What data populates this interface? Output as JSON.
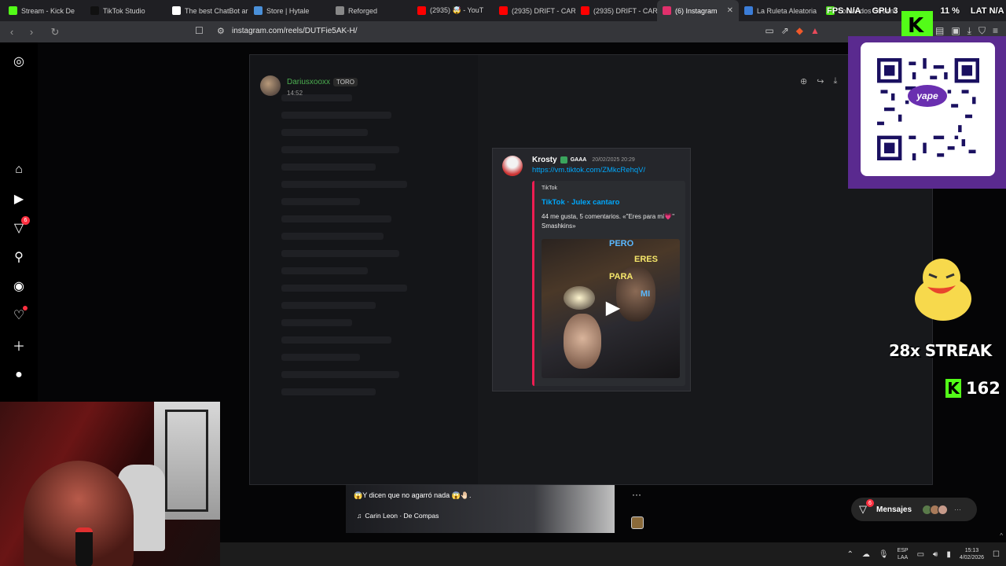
{
  "tabs": [
    {
      "label": "Stream - Kick De",
      "color": "#53fc18"
    },
    {
      "label": "TikTok Studio",
      "color": "#111111"
    },
    {
      "label": "The best ChatBot ar",
      "color": "#ffffff"
    },
    {
      "label": "Store | Hytale",
      "color": "#4a90d9"
    },
    {
      "label": "Reforged",
      "color": "#888888"
    },
    {
      "label": "(2935) 🤯 - YouT",
      "color": "#ff0000"
    },
    {
      "label": "(2935) DRIFT - CAR",
      "color": "#ff0000"
    },
    {
      "label": "(2935) DRIFT - CAR",
      "color": "#ff0000"
    },
    {
      "label": "(6) Instagram",
      "color": "#e1306c",
      "active": true
    },
    {
      "label": "La Ruleta Aleatoria",
      "color": "#3b7dd8"
    },
    {
      "label": "comandos Stream",
      "color": "#53fc18"
    }
  ],
  "address": {
    "url": "instagram.com/reels/DUTFie5AK-H/"
  },
  "overlay": {
    "fps_label": "FPS",
    "fps_value": "N/A",
    "gpu_label": "GPU",
    "gpu_value": "3",
    "cpu_value": "11 %",
    "lat_label": "LAT",
    "lat_value": "N/A"
  },
  "sidebar": {
    "reels_badge": "6"
  },
  "post": {
    "username": "Dariusxooxx",
    "tag": "TORO",
    "time": "14:52"
  },
  "message": {
    "author": "Krosty",
    "role": "GAAA",
    "date": "20/02/2025 20:29",
    "link": "https://vm.tiktok.com/ZMkcRehqV/",
    "embed_provider": "TikTok",
    "embed_title": "TikTok · Julex cantaro",
    "embed_desc": "44 me gusta, 5 comentarios. «\"Eres para mí💗\" Smashkins»",
    "video_words": [
      "PERO",
      "ERES",
      "PARA",
      "MI"
    ]
  },
  "reel": {
    "caption": "😱Y dicen que no agarró nada 😱🤚🏻.",
    "music": "Carin Leon · De Compas"
  },
  "streak": {
    "text": "28x STREAK",
    "kick_count": "162"
  },
  "messages_btn": {
    "label": "Mensajes",
    "badge": "6"
  },
  "qr": {
    "brand": "yape"
  },
  "taskbar": {
    "lang1": "ESP",
    "lang2": "LAA",
    "time": "15:13",
    "date": "4/02/2026"
  }
}
